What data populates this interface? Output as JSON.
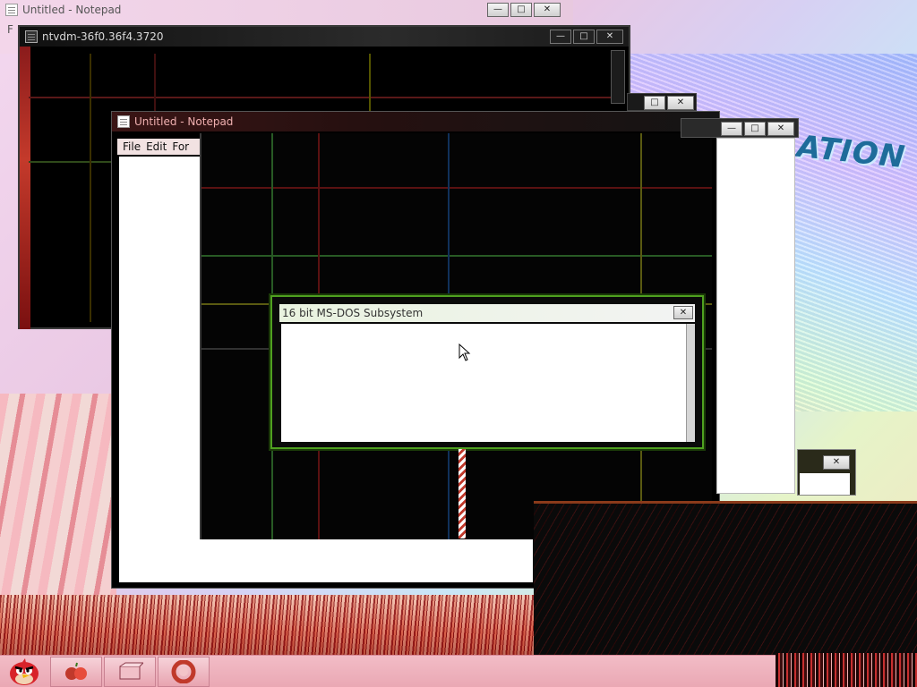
{
  "windows": {
    "notepad_back": {
      "title": "Untitled - Notepad",
      "menu_initial": "F"
    },
    "ntvdm": {
      "title": "ntvdm-36f0.36f4.3720"
    },
    "notepad_main": {
      "title": "Untitled - Notepad",
      "menu": {
        "file": "File",
        "edit": "Edit",
        "format": "For"
      }
    },
    "dos_dialog": {
      "title": "16 bit MS-DOS Subsystem"
    }
  },
  "desktop": {
    "logo_text": "ATION"
  },
  "taskbar": {
    "items": [
      {
        "icon": "angry-bird-icon"
      },
      {
        "icon": "fruit-icon"
      },
      {
        "icon": "package-icon"
      },
      {
        "icon": "lifebuoy-icon"
      }
    ]
  },
  "colors": {
    "dos_border": "#4fa020",
    "taskbar": "#eaa8b4",
    "accent_red": "#c0392b"
  }
}
